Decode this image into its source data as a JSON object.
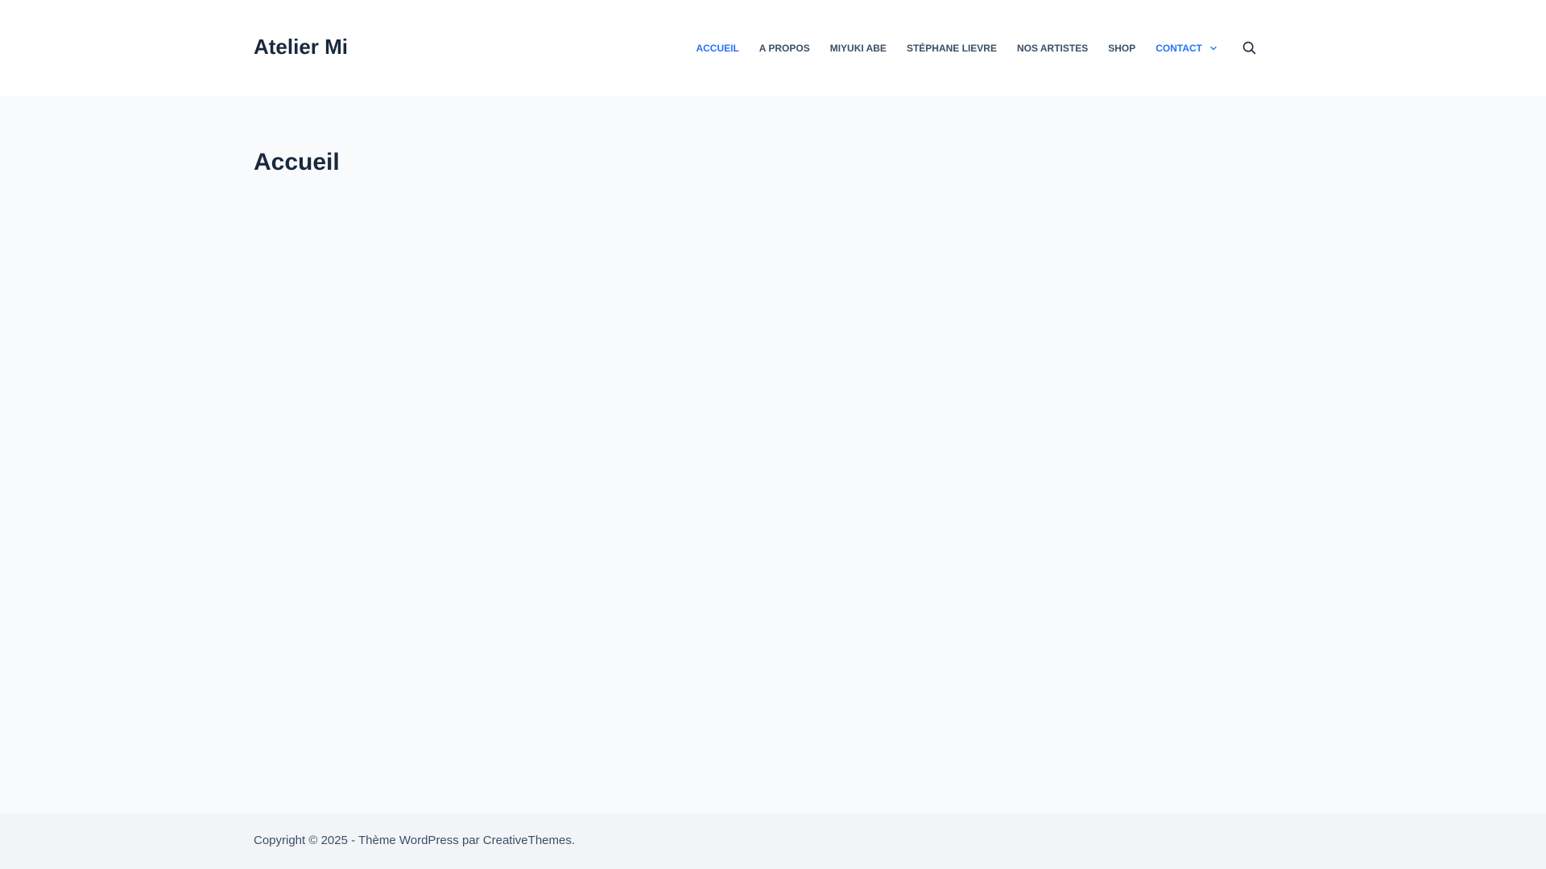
{
  "header": {
    "site_title": "Atelier Mi",
    "nav": [
      {
        "label": "ACCUEIL",
        "active": true
      },
      {
        "label": "A PROPOS"
      },
      {
        "label": "MIYUKI ABE"
      },
      {
        "label": "STÉPHANE LIEVRE"
      },
      {
        "label": "NOS ARTISTES"
      },
      {
        "label": "SHOP"
      },
      {
        "label": "CONTACT",
        "has_dropdown": true
      }
    ],
    "search_icon": "search-icon"
  },
  "main": {
    "page_title": "Accueil"
  },
  "footer": {
    "copyright_prefix": "Copyright © 2025 - ",
    "theme_link": "Thème WordPress",
    "by": " par ",
    "author_link": "CreativeThemes",
    "suffix": "."
  },
  "colors": {
    "accent": "#2872fa",
    "heading": "#192a3d",
    "text": "#3a4f66",
    "page_bg": "#f9fafb",
    "header_bg": "#ffffff",
    "footer_bg": "#f2f5f7"
  }
}
